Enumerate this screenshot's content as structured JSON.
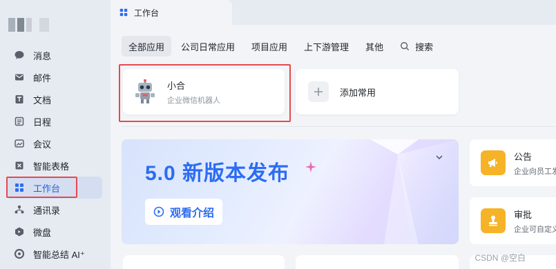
{
  "sidebar": {
    "items": [
      {
        "label": "消息",
        "icon": "chat-bubble-icon"
      },
      {
        "label": "邮件",
        "icon": "mail-icon"
      },
      {
        "label": "文档",
        "icon": "document-icon"
      },
      {
        "label": "日程",
        "icon": "calendar-icon"
      },
      {
        "label": "会议",
        "icon": "meeting-icon"
      },
      {
        "label": "智能表格",
        "icon": "smart-sheet-icon"
      },
      {
        "label": "工作台",
        "icon": "workbench-grid-icon"
      },
      {
        "label": "通讯录",
        "icon": "contacts-icon"
      },
      {
        "label": "微盘",
        "icon": "drive-icon"
      },
      {
        "label": "智能总结 AI⁺",
        "icon": "ai-summary-icon"
      }
    ],
    "active_index": 6,
    "accent": "#1f5fd6"
  },
  "tab": {
    "label": "工作台",
    "icon": "workbench-grid-icon"
  },
  "categories": [
    {
      "label": "全部应用"
    },
    {
      "label": "公司日常应用"
    },
    {
      "label": "项目应用"
    },
    {
      "label": "上下游管理"
    },
    {
      "label": "其他"
    },
    {
      "label": "搜索",
      "icon": "search-icon"
    }
  ],
  "common_apps": {
    "bot": {
      "title": "小合",
      "subtitle": "企业微信机器人",
      "icon": "robot-icon"
    },
    "add": {
      "label": "添加常用",
      "icon": "plus-icon"
    }
  },
  "banner": {
    "title": "5.0 新版本发布",
    "button": "观看介绍"
  },
  "side_cards": [
    {
      "title": "公告",
      "subtitle": "企业向员工发",
      "icon": "megaphone-icon"
    },
    {
      "title": "审批",
      "subtitle": "企业可自定义",
      "icon": "stamp-icon"
    }
  ],
  "watermark": "CSDN @空白",
  "colors": {
    "highlight_border": "#e5484d",
    "banner_blue": "#2c6cf3",
    "notice_yellow": "#f6b327"
  }
}
